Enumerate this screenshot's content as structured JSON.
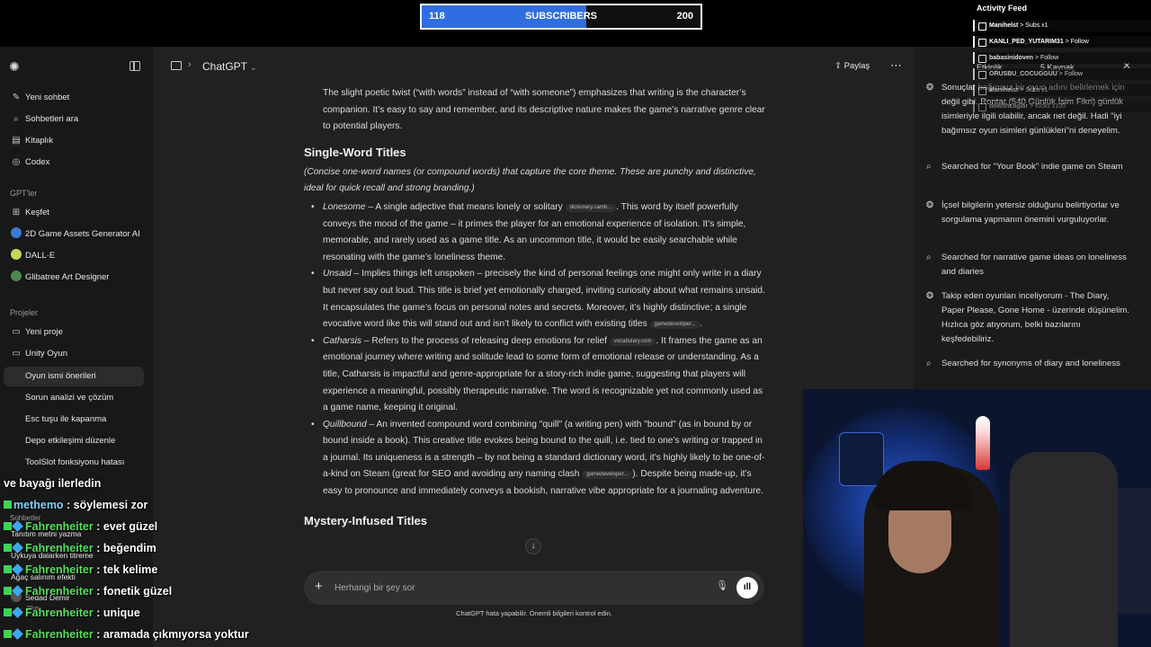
{
  "stream_goal": {
    "current": "118",
    "label": "SUBSCRIBERS",
    "target": "200",
    "fill_fraction": 0.59
  },
  "activity_feed": {
    "title": "Activity Feed",
    "items": [
      {
        "user": "Manihelst",
        "action": "> Subs x1"
      },
      {
        "user": "KANLI_PED_YUTARIM31",
        "action": "> Follow"
      },
      {
        "user": "babasinidoven",
        "action": "> Follow"
      },
      {
        "user": "ORUSBU_COCUGGUU",
        "action": "> Follow"
      },
      {
        "user": "Manihelst",
        "action": "> Subs x1"
      },
      {
        "user": "dowithcaglar",
        "action": "> Kicks x100"
      }
    ]
  },
  "sidebar": {
    "items": [
      {
        "icon": "edit-icon",
        "glyph": "✎",
        "label": "Yeni sohbet"
      },
      {
        "icon": "search-icon",
        "glyph": "⌕",
        "label": "Sohbetleri ara"
      },
      {
        "icon": "library-icon",
        "glyph": "▤",
        "label": "Kitaplık"
      },
      {
        "icon": "codex-icon",
        "glyph": "◎",
        "label": "Codex"
      }
    ],
    "gpts_heading": "GPT'ler",
    "gpts": [
      {
        "label": "Keşfet",
        "color": ""
      },
      {
        "label": "2D Game Assets Generator AI",
        "color": "#3a7bd5"
      },
      {
        "label": "DALL·E",
        "color": "#c9d65a"
      },
      {
        "label": "Glibatree Art Designer",
        "color": "#4a8a4a"
      }
    ],
    "projects_heading": "Projeler",
    "projects": [
      {
        "label": "Yeni proje"
      },
      {
        "label": "Unity Oyun"
      }
    ],
    "project_chats": [
      "Oyun ismi önerileri",
      "Sorun analizi ve çözüm",
      "Esc tuşu ile kapanma",
      "Depo etkileşimi düzenle",
      "ToolSlot fonksiyonu hatası"
    ],
    "chats_heading": "Sohbetler",
    "chats": [
      "Tanıtım metni yazma",
      "Uykuya dalarken titreme",
      "Ağaç salınım efekti"
    ],
    "user_name": "Sedad Demir",
    "user_plan": "Plus"
  },
  "header": {
    "model": "ChatGPT",
    "share_label": "Paylaş"
  },
  "content": {
    "intro": "The slight poetic twist (“with words” instead of “with someone”) emphasizes that writing is the character’s companion. It’s easy to say and remember, and its descriptive nature makes the game’s narrative genre clear to potential players.",
    "section_title": "Single-Word Titles",
    "section_desc": "(Concise one-word names (or compound words) that capture the core theme. These are punchy and distinctive, ideal for quick recall and strong branding.)",
    "items": [
      {
        "name": "Lonesome",
        "text_a": " – A single adjective that means lonely or solitary ",
        "chip": "dictionary.camb...",
        "text_b": ". This word by itself powerfully conveys the mood of the game – it primes the player for an emotional experience of isolation. It’s simple, memorable, and rarely used as a game title. As an uncommon title, it would be easily searchable while resonating with the game’s loneliness theme."
      },
      {
        "name": "Unsaid",
        "text_a": " – Implies things left unspoken – precisely the kind of personal feelings one might only write in a diary but never say out loud. This title is brief yet emotionally charged, inviting curiosity about what remains unsaid. It encapsulates the game’s focus on personal notes and secrets. Moreover, it’s highly distinctive; a single evocative word like this will stand out and isn’t likely to conflict with existing titles ",
        "chip": "gamedeveloper...",
        "text_b": "."
      },
      {
        "name": "Catharsis",
        "text_a": " – Refers to the process of releasing deep emotions for relief ",
        "chip": "vocabulary.com",
        "text_b": ". It frames the game as an emotional journey where writing and solitude lead to some form of emotional release or understanding. As a title, Catharsis is impactful and genre-appropriate for a story-rich indie game, suggesting that players will experience a meaningful, possibly therapeutic narrative. The word is recognizable yet not commonly used as a game name, keeping it original."
      },
      {
        "name": "Quillbound",
        "text_a": " – An invented compound word combining \"quill\" (a writing pen) with \"bound\" (as in bound by or bound inside a book). This creative title evokes being bound to the quill, i.e. tied to one’s writing or trapped in a journal. Its uniqueness is a strength – by not being a standard dictionary word, it’s highly likely to be one-of-a-kind on Steam (great for SEO and avoiding any naming clash ",
        "chip": "gamedeveloper...",
        "text_b": "). Despite being made-up, it’s easy to pronounce and immediately conveys a bookish, narrative vibe appropriate for a journaling adventure."
      }
    ],
    "next_section_title": "Mystery-Infused Titles"
  },
  "input": {
    "placeholder": "Herhangi bir şey sor"
  },
  "disclaimer": "ChatGPT hata yapabilir. Önemli bilgileri kontrol edin.",
  "right_panel": {
    "tabs": [
      "Etkinlik",
      "5 Kaynak"
    ],
    "activities": [
      {
        "icon": "reasoning-icon",
        "glyph": "❂",
        "text": "Sonuçlar bağımsız bir oyun adını belirlemek için değil gibi. Rontar (540 Günlük İsim Fikri) günlük isimleriyle ilgili olabilir, ancak net değil. Hadi \"iyi bağımsız oyun isimleri günlükleri\"ni deneyelim."
      },
      {
        "icon": "search-icon",
        "glyph": "⌕",
        "text": "Searched for \"Your Book\" indie game on Steam"
      },
      {
        "icon": "reasoning-icon",
        "glyph": "❂",
        "text": "İçsel bilgilerin yetersiz olduğunu belirtiyorlar ve sorgulama yapmanın önemini vurguluyorlar."
      },
      {
        "icon": "search-icon",
        "glyph": "⌕",
        "text": "Searched for narrative game ideas on loneliness and diaries"
      },
      {
        "icon": "reasoning-icon",
        "glyph": "❂",
        "text": "Takip eden oyunları inceliyorum - The Diary, Paper Please, Gone Home - üzerinde düşünelim. Hızlıca göz atıyorum, belki bazılarını keşfedebiliriz."
      },
      {
        "icon": "search-icon",
        "glyph": "⌕",
        "text": "Searched for synonyms of diary and loneliness"
      }
    ]
  },
  "stream_chat": [
    {
      "user": "",
      "text": "ve bayağı ilerledin"
    },
    {
      "user": "methemo",
      "text": " : söylemesi zor"
    },
    {
      "user": "Fahrenheiter",
      "text": " : evet güzel"
    },
    {
      "user": "Fahrenheiter",
      "text": " : beğendim"
    },
    {
      "user": "Fahrenheiter",
      "text": " : tek kelime"
    },
    {
      "user": "Fahrenheiter",
      "text": " : fonetik güzel"
    },
    {
      "user": "Fahrenheiter",
      "text": " : unique"
    },
    {
      "user": "Fahrenheiter",
      "text": " : aramada çıkmıyorsa yoktur"
    }
  ]
}
